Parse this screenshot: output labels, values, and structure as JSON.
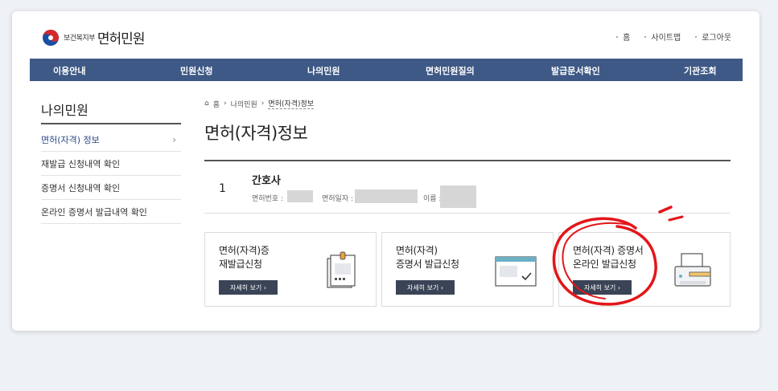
{
  "header": {
    "ministry": "보건복지부",
    "service": "면허민원",
    "util": [
      "홈",
      "사이트맵",
      "로그아웃"
    ]
  },
  "gnb": [
    "이용안내",
    "민원신청",
    "나의민원",
    "면허민원질의",
    "발급문서확인",
    "기관조회"
  ],
  "lnb": {
    "title": "나의민원",
    "items": [
      {
        "label": "면허(자격) 정보",
        "active": true
      },
      {
        "label": "재발급 신청내역 확인",
        "active": false
      },
      {
        "label": "증명서 신청내역 확인",
        "active": false
      },
      {
        "label": "온라인 증명서 발급내역 확인",
        "active": false
      }
    ]
  },
  "breadcrumb": [
    "홈",
    "나의민원",
    "면허(자격)정보"
  ],
  "page_title": "면허(자격)정보",
  "license": {
    "number": "1",
    "name": "간호사",
    "license_no_label": "면허번호 :",
    "license_date_label": "면허일자 :",
    "holder_label": "이름 :"
  },
  "tiles": [
    {
      "title": "면허(자격)증\n재발급신청",
      "button": "자세히 보기 ›",
      "icon": "id-card-clipboard-icon"
    },
    {
      "title": "면허(자격)\n증명서 발급신청",
      "button": "자세히 보기 ›",
      "icon": "browser-window-check-icon"
    },
    {
      "title": "면허(자격) 증명서\n온라인 발급신청",
      "button": "자세히 보기 ›",
      "icon": "printer-icon"
    }
  ],
  "colors": {
    "nav": "#3e5985",
    "button": "#3a4456",
    "annotation": "#e3161a"
  }
}
